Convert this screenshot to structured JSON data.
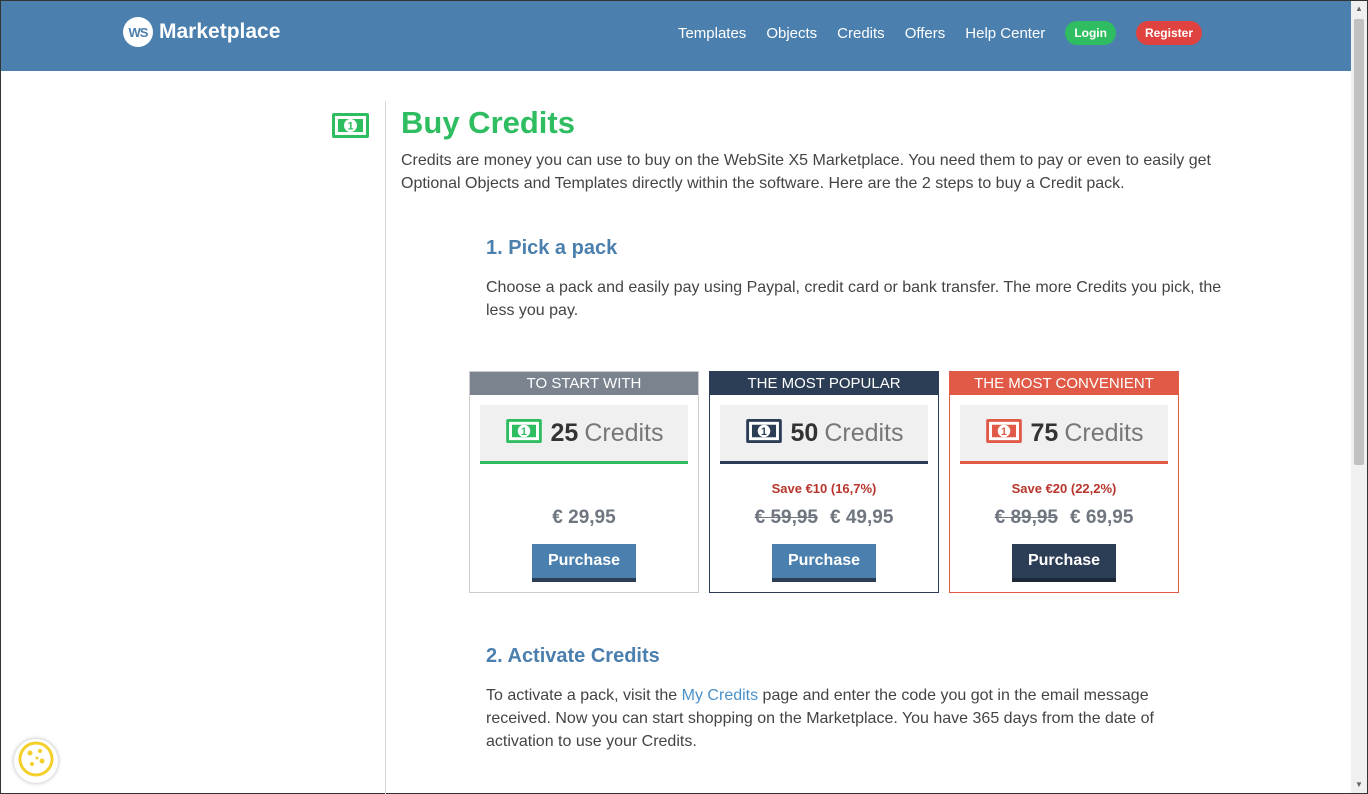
{
  "header": {
    "logo_badge": "WS",
    "logo_text": "Marketplace",
    "nav": [
      "Templates",
      "Objects",
      "Credits",
      "Offers",
      "Help Center"
    ],
    "login": "Login",
    "register": "Register"
  },
  "colors": {
    "header": "#4a7fae",
    "green": "#2ebd60",
    "red": "#e0433f",
    "navy": "#2c3e55",
    "gray": "#7a838e"
  },
  "main": {
    "title": "Buy Credits",
    "intro": "Credits are money you can use to buy on the WebSite X5 Marketplace. You need them to pay or even to easily get Optional Objects and Templates directly within the software. Here are the 2 steps to buy a Credit pack.",
    "step1_title": "1. Pick a pack",
    "step1_text": "Choose a pack and easily pay using Paypal, credit card or bank transfer. The more Credits you pick, the less you pay.",
    "step2_title": "2. Activate Credits",
    "step2_text_before": "To activate a pack, visit the ",
    "step2_link": "My Credits",
    "step2_text_after": " page and enter the code you got in the email message received. Now you can start shopping on the Marketplace. You have 365 days from the date of activation to use your Credits."
  },
  "packs": [
    {
      "label": "TO START WITH",
      "amount": "25",
      "unit": "Credits",
      "save": "",
      "old_price": "",
      "price": "€ 29,95",
      "button": "Purchase"
    },
    {
      "label": "THE MOST POPULAR",
      "amount": "50",
      "unit": "Credits",
      "save": "Save €10  (16,7%)",
      "old_price": "€ 59,95",
      "price": "€ 49,95",
      "button": "Purchase"
    },
    {
      "label": "THE MOST CONVENIENT",
      "amount": "75",
      "unit": "Credits",
      "save": "Save €20  (22,2%)",
      "old_price": "€ 89,95",
      "price": "€ 69,95",
      "button": "Purchase"
    }
  ],
  "icons": [
    "money-bill-icon",
    "cookie-icon"
  ]
}
